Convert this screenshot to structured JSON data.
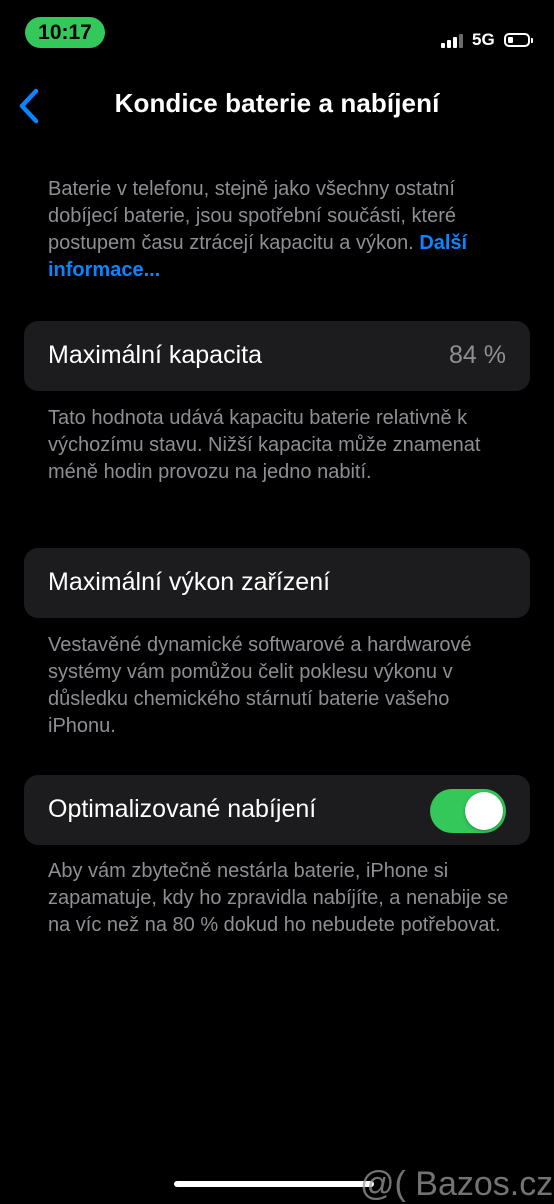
{
  "status_bar": {
    "time": "10:17",
    "network": "5G",
    "signal_bars": 4,
    "signal_bars_active": 3,
    "battery_level": 0.3,
    "time_pill_color": "#34c759"
  },
  "nav": {
    "back_icon": "chevron-left-icon",
    "title": "Kondice baterie a nabíjení",
    "accent_color": "#0a84ff"
  },
  "intro": {
    "text": "Baterie v telefonu, stejně jako všechny ostatní dobíjecí baterie, jsou spotřební součásti, které postupem času ztrácejí kapacitu a výkon. ",
    "link": "Další informace..."
  },
  "max_capacity": {
    "label": "Maximální kapacita",
    "value": "84 %",
    "description": "Tato hodnota udává kapacitu baterie relativně k výchozímu stavu. Nižší kapacita může znamenat méně hodin provozu na jedno nabití."
  },
  "peak_performance": {
    "label": "Maximální výkon zařízení",
    "description": "Vestavěné dynamické softwarové a hardwarové systémy vám pomůžou čelit poklesu výkonu v důsledku chemického stárnutí baterie vašeho iPhonu."
  },
  "optimized_charging": {
    "label": "Optimalizované nabíjení",
    "enabled": true,
    "toggle_color": "#34c759",
    "description": "Aby vám zbytečně nestárla baterie, iPhone si zapamatuje, kdy ho zpravidla nabíjíte, a nenabije se na víc než na 80 % dokud ho nebudete potřebovat."
  },
  "watermark": "@( Bazos.cz"
}
